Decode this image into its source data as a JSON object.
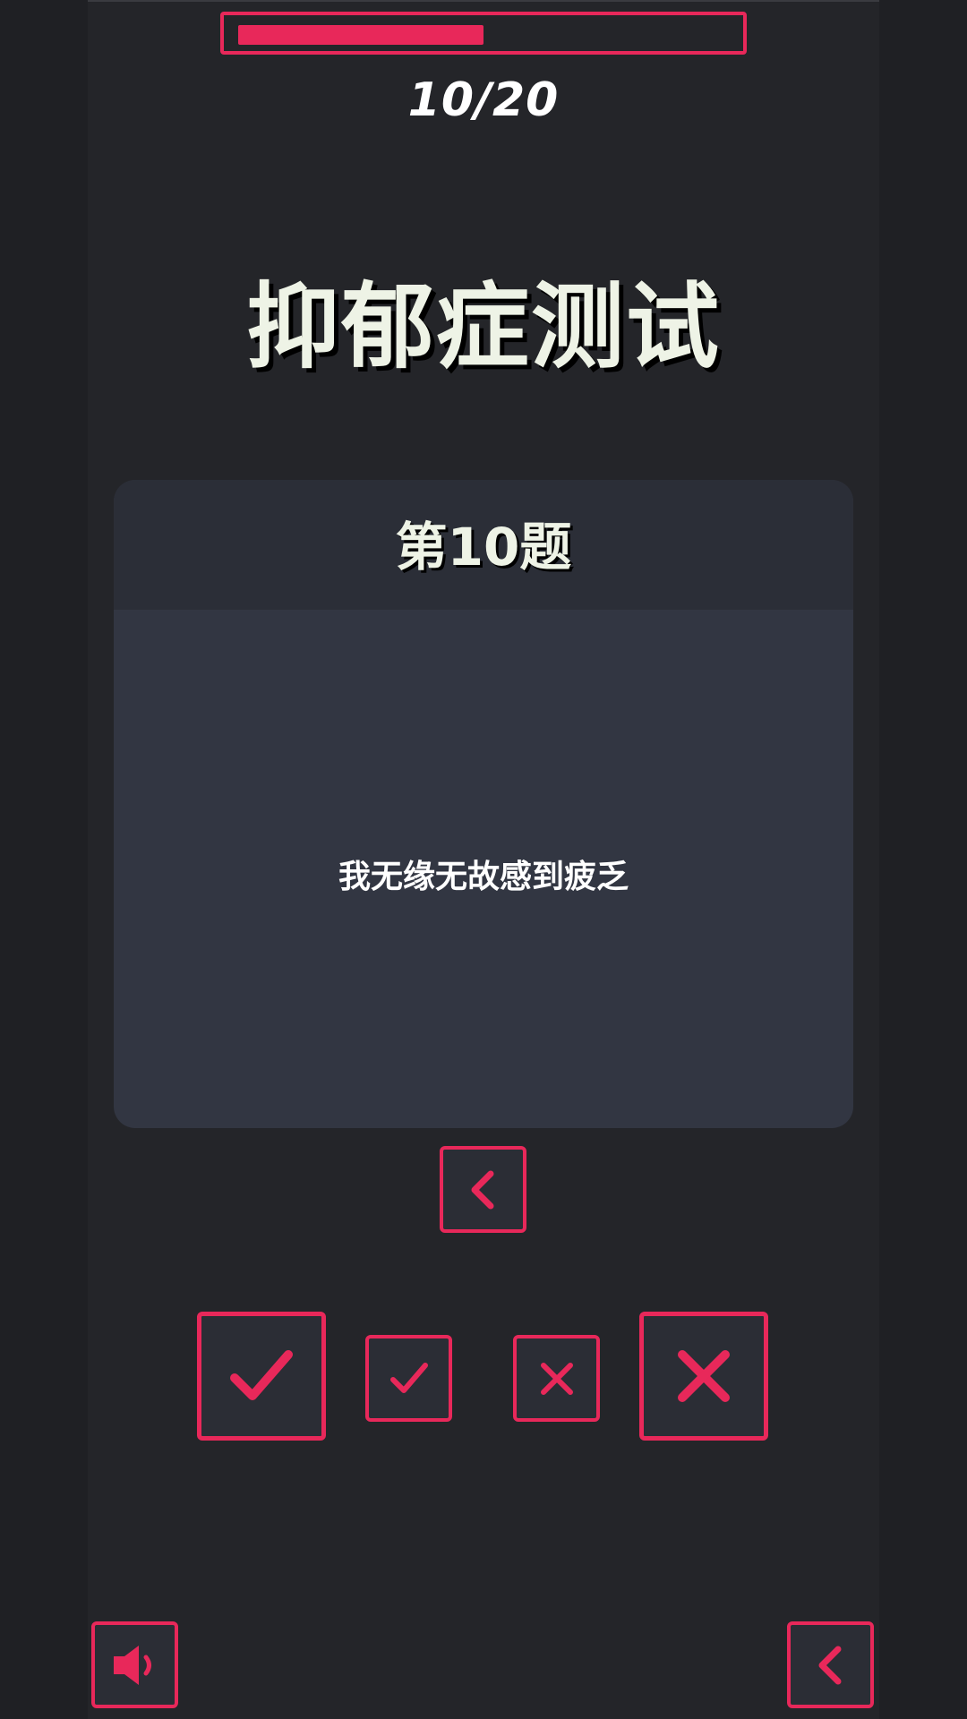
{
  "progress": {
    "current": 10,
    "total": 20,
    "label": "10/20",
    "fraction": 0.5
  },
  "title": "抑郁症测试",
  "question": {
    "number_label": "第10题",
    "text": "我无缘无故感到疲乏"
  },
  "buttons": {
    "prev": {
      "icon": "chevron-left-icon"
    },
    "strong_yes": {
      "icon": "check-icon"
    },
    "yes": {
      "icon": "check-icon"
    },
    "no": {
      "icon": "close-icon"
    },
    "strong_no": {
      "icon": "close-icon"
    },
    "sound": {
      "icon": "speaker-icon"
    },
    "back": {
      "icon": "chevron-left-icon"
    }
  },
  "colors": {
    "accent": "#e8285a",
    "background": "#242529",
    "card": "#323642",
    "card_header": "#2b2e37",
    "text": "#eef3e6"
  }
}
